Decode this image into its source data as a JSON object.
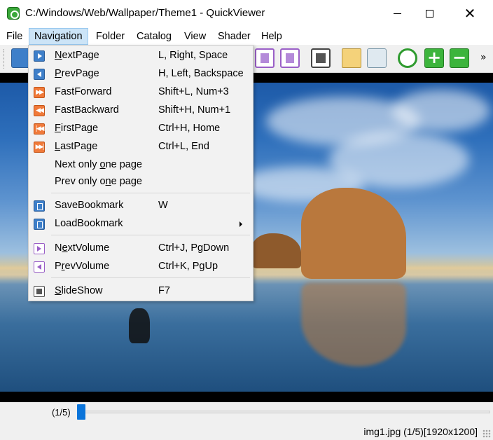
{
  "window": {
    "title": "C:/Windows/Web/Wallpaper/Theme1 - QuickViewer",
    "app_icon": "quickviewer-app-icon"
  },
  "menubar": {
    "items": [
      {
        "label": "File"
      },
      {
        "label": "Navigation"
      },
      {
        "label": "Folder"
      },
      {
        "label": "Catalog"
      },
      {
        "label": "View"
      },
      {
        "label": "Shader"
      },
      {
        "label": "Help"
      }
    ],
    "active": "Navigation"
  },
  "toolbar": {
    "overflow_label": "»",
    "icons": [
      "prev-arrow-icon",
      "prev-volume-icon",
      "next-volume-icon",
      "slideshow-icon",
      "folder-icon",
      "catalog-icon",
      "refresh-icon",
      "zoom-in-icon",
      "zoom-out-icon"
    ]
  },
  "navigation_menu": {
    "items": [
      {
        "label_pre": "",
        "label_u": "N",
        "label_post": "extPage",
        "shortcut": "L, Right, Space",
        "icon": "next-page-icon"
      },
      {
        "label_pre": "",
        "label_u": "P",
        "label_post": "revPage",
        "shortcut": "H, Left, Backspace",
        "icon": "prev-page-icon"
      },
      {
        "label_pre": "FastForward",
        "label_u": "",
        "label_post": "",
        "shortcut": "Shift+L, Num+3",
        "icon": "fast-forward-icon"
      },
      {
        "label_pre": "FastBackward",
        "label_u": "",
        "label_post": "",
        "shortcut": "Shift+H, Num+1",
        "icon": "fast-backward-icon"
      },
      {
        "label_pre": "",
        "label_u": "F",
        "label_post": "irstPage",
        "shortcut": "Ctrl+H, Home",
        "icon": "first-page-icon"
      },
      {
        "label_pre": "",
        "label_u": "L",
        "label_post": "astPage",
        "shortcut": "Ctrl+L, End",
        "icon": "last-page-icon"
      },
      {
        "label_pre": "Next only ",
        "label_u": "o",
        "label_post": "ne page",
        "shortcut": "",
        "icon": ""
      },
      {
        "label_pre": "Prev only o",
        "label_u": "n",
        "label_post": "e page",
        "shortcut": "",
        "icon": ""
      },
      {
        "label_pre": "SaveBookmark",
        "label_u": "",
        "label_post": "",
        "shortcut": "W",
        "icon": "save-bookmark-icon"
      },
      {
        "label_pre": "LoadBookmark",
        "label_u": "",
        "label_post": "",
        "shortcut": "",
        "icon": "load-bookmark-icon",
        "submenu": true
      },
      {
        "label_pre": "N",
        "label_u": "e",
        "label_post": "xtVolume",
        "shortcut": "Ctrl+J, PgDown",
        "icon": "next-volume-icon"
      },
      {
        "label_pre": "P",
        "label_u": "r",
        "label_post": "evVolume",
        "shortcut": "Ctrl+K, PgUp",
        "icon": "prev-volume-icon"
      },
      {
        "label_pre": "",
        "label_u": "S",
        "label_post": "lideShow",
        "shortcut": "F7",
        "icon": "slideshow-icon"
      }
    ]
  },
  "viewer": {
    "image_description_icon": "wallpaper-image"
  },
  "bottom": {
    "page_counter": "(1/5)",
    "slider_value": 0.0,
    "status": "img1.jpg (1/5)[1920x1200]"
  },
  "colors": {
    "menu_highlight": "#cce4f7",
    "slider_thumb": "#0a74da",
    "toolbar_bg": "#f0f0f0"
  }
}
